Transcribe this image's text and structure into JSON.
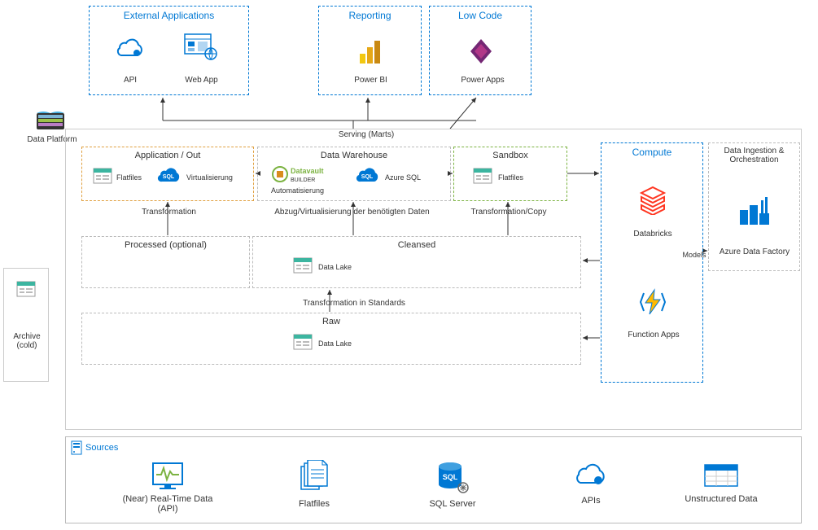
{
  "external_apps": {
    "title": "External Applications",
    "api": "API",
    "webapp": "Web App"
  },
  "reporting": {
    "title": "Reporting",
    "powerbi": "Power BI"
  },
  "lowcode": {
    "title": "Low Code",
    "powerapps": "Power Apps"
  },
  "data_platform": "Data Platform",
  "serving_label": "Serving (Marts)",
  "app_out": {
    "title": "Application / Out",
    "flatfiles": "Flatfiles",
    "virt": "Virtualisierung"
  },
  "dw": {
    "title": "Data Warehouse",
    "auto": "Automatisierung",
    "azuresql": "Azure SQL",
    "dvb": "Datavault"
  },
  "sandbox": {
    "title": "Sandbox",
    "flatfiles": "Flatfiles"
  },
  "compute": {
    "title": "Compute",
    "databricks": "Databricks",
    "fapps": "Function Apps"
  },
  "ingestion": {
    "title": "Data Ingestion & Orchestration",
    "adf": "Azure Data Factory"
  },
  "models_label": "Models",
  "transformation": "Transformation",
  "abzug": "Abzug/Virtualisierung der benötigten Daten",
  "trans_copy": "Transformation/Copy",
  "processed": {
    "title": "Processed (optional)"
  },
  "cleansed": {
    "title": "Cleansed",
    "datalake": "Data Lake"
  },
  "transform_std": "Transformation in Standards",
  "raw": {
    "title": "Raw",
    "datalake": "Data Lake"
  },
  "archive": "Archive (cold)",
  "sources": {
    "title": "Sources",
    "realtime": "(Near) Real-Time Data (API)",
    "flatfiles": "Flatfiles",
    "sqlserver": "SQL Server",
    "apis": "APIs",
    "unstructured": "Unstructured Data"
  }
}
